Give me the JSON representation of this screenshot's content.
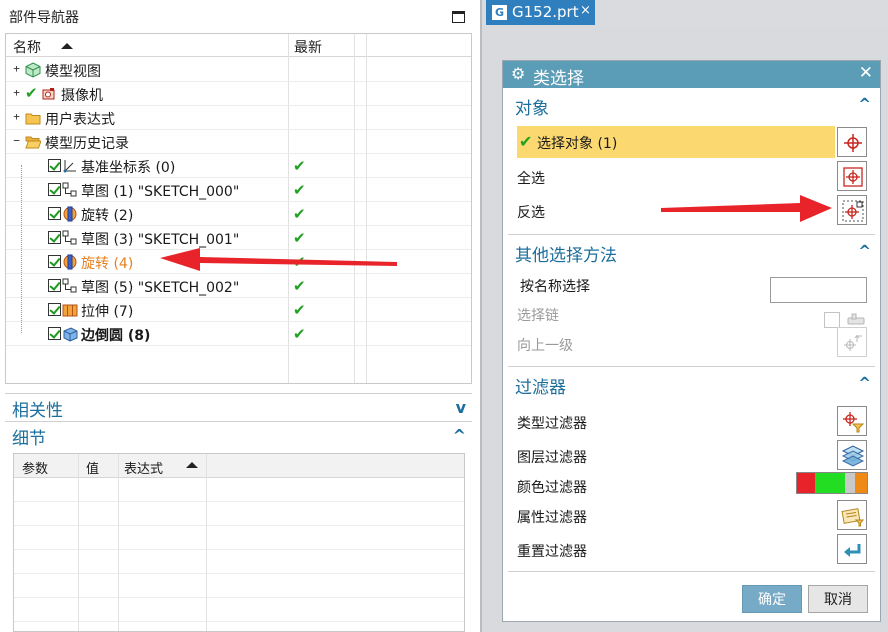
{
  "navigator": {
    "title": "部件导航器",
    "columns": {
      "name": "名称",
      "latest": "最新"
    },
    "rows": [
      {
        "label": "模型视图",
        "expander": "+",
        "icon": "model-views-icon"
      },
      {
        "label": "摄像机",
        "expander": "+",
        "icon": "camera-icon"
      },
      {
        "label": "用户表达式",
        "expander": "+",
        "icon": "folder-icon"
      },
      {
        "label": "模型历史记录",
        "expander": "−",
        "icon": "folder-open-icon"
      },
      {
        "label": "基准坐标系 (0)",
        "checked": true,
        "latest": "✔",
        "icon": "datum-csys-icon"
      },
      {
        "label": "草图 (1) \"SKETCH_000\"",
        "checked": true,
        "latest": "✔",
        "icon": "sketch-icon"
      },
      {
        "label": "旋转 (2)",
        "checked": true,
        "latest": "✔",
        "icon": "revolve-icon"
      },
      {
        "label": "草图 (3) \"SKETCH_001\"",
        "checked": true,
        "latest": "✔",
        "icon": "sketch-icon"
      },
      {
        "label": "旋转 (4)",
        "checked": true,
        "latest": "✔",
        "icon": "revolve-icon",
        "highlight": "#e8801f"
      },
      {
        "label": "草图 (5) \"SKETCH_002\"",
        "checked": true,
        "latest": "✔",
        "icon": "sketch-icon"
      },
      {
        "label": "拉伸 (7)",
        "checked": true,
        "latest": "✔",
        "icon": "extrude-icon"
      },
      {
        "label": "边倒圆 (8)",
        "checked": true,
        "latest": "✔",
        "icon": "edge-blend-icon",
        "bold": true
      }
    ],
    "dependencies_label": "相关性",
    "details_label": "细节",
    "details_columns": {
      "param": "参数",
      "value": "值",
      "expression": "表达式"
    }
  },
  "document_tab": {
    "label": "G152.prt",
    "close": "×"
  },
  "dialog": {
    "title": "类选择",
    "close": "✕",
    "object_group": {
      "header": "对象",
      "select_object": "选择对象 (1)",
      "select_all": "全选",
      "invert_selection": "反选"
    },
    "other_methods_group": {
      "header": "其他选择方法",
      "select_by_name": "按名称选择",
      "select_by_name_value": "",
      "select_chain": "选择链",
      "up_one_level": "向上一级"
    },
    "filter_group": {
      "header": "过滤器",
      "type_filter": "类型过滤器",
      "layer_filter": "图层过滤器",
      "color_filter": "颜色过滤器",
      "attribute_filter": "属性过滤器",
      "reset_filter": "重置过滤器"
    },
    "ok_label": "确定",
    "cancel_label": "取消"
  },
  "colors": {
    "accent_blue": "#1c6e9c",
    "dialog_title_bg": "#5b9cb7",
    "highlight_row": "#fbd870",
    "check_green": "#22a022",
    "orange_text": "#e8801f",
    "arrow_red": "#e8242a",
    "color_filter_swatches": [
      "#e8242a",
      "#22dd22",
      "#22dd22",
      "#c9c9c9",
      "#f08a16"
    ]
  }
}
